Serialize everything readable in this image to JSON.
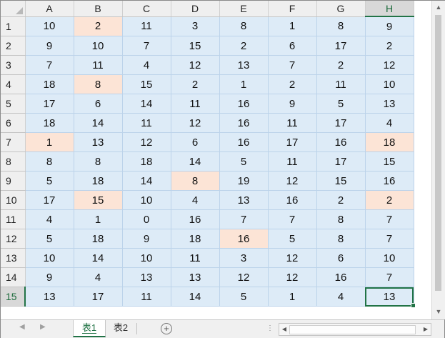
{
  "spreadsheet": {
    "columns": [
      "A",
      "B",
      "C",
      "D",
      "E",
      "F",
      "G",
      "H"
    ],
    "rows": [
      {
        "header": "1",
        "cells": [
          {
            "v": "10"
          },
          {
            "v": "2",
            "hl": true
          },
          {
            "v": "11"
          },
          {
            "v": "3"
          },
          {
            "v": "8"
          },
          {
            "v": "1"
          },
          {
            "v": "8"
          },
          {
            "v": "9"
          }
        ]
      },
      {
        "header": "2",
        "cells": [
          {
            "v": "9"
          },
          {
            "v": "10"
          },
          {
            "v": "7"
          },
          {
            "v": "15"
          },
          {
            "v": "2"
          },
          {
            "v": "6"
          },
          {
            "v": "17"
          },
          {
            "v": "2"
          }
        ]
      },
      {
        "header": "3",
        "cells": [
          {
            "v": "7"
          },
          {
            "v": "11"
          },
          {
            "v": "4"
          },
          {
            "v": "12"
          },
          {
            "v": "13"
          },
          {
            "v": "7"
          },
          {
            "v": "2"
          },
          {
            "v": "12"
          }
        ]
      },
      {
        "header": "4",
        "cells": [
          {
            "v": "18"
          },
          {
            "v": "8",
            "hl": true
          },
          {
            "v": "15"
          },
          {
            "v": "2"
          },
          {
            "v": "1"
          },
          {
            "v": "2"
          },
          {
            "v": "11"
          },
          {
            "v": "10"
          }
        ]
      },
      {
        "header": "5",
        "cells": [
          {
            "v": "17"
          },
          {
            "v": "6"
          },
          {
            "v": "14"
          },
          {
            "v": "11"
          },
          {
            "v": "16"
          },
          {
            "v": "9"
          },
          {
            "v": "5"
          },
          {
            "v": "13"
          }
        ]
      },
      {
        "header": "6",
        "cells": [
          {
            "v": "18"
          },
          {
            "v": "14"
          },
          {
            "v": "11"
          },
          {
            "v": "12"
          },
          {
            "v": "16"
          },
          {
            "v": "11"
          },
          {
            "v": "17"
          },
          {
            "v": "4"
          }
        ]
      },
      {
        "header": "7",
        "cells": [
          {
            "v": "1",
            "hl": true
          },
          {
            "v": "13"
          },
          {
            "v": "12"
          },
          {
            "v": "6"
          },
          {
            "v": "16"
          },
          {
            "v": "17"
          },
          {
            "v": "16"
          },
          {
            "v": "18",
            "hl": true
          }
        ]
      },
      {
        "header": "8",
        "cells": [
          {
            "v": "8"
          },
          {
            "v": "8"
          },
          {
            "v": "18"
          },
          {
            "v": "14"
          },
          {
            "v": "5"
          },
          {
            "v": "11"
          },
          {
            "v": "17"
          },
          {
            "v": "15"
          }
        ]
      },
      {
        "header": "9",
        "cells": [
          {
            "v": "5"
          },
          {
            "v": "18"
          },
          {
            "v": "14"
          },
          {
            "v": "8",
            "hl": true
          },
          {
            "v": "19"
          },
          {
            "v": "12"
          },
          {
            "v": "15"
          },
          {
            "v": "16"
          }
        ]
      },
      {
        "header": "10",
        "cells": [
          {
            "v": "17"
          },
          {
            "v": "15",
            "hl": true
          },
          {
            "v": "10"
          },
          {
            "v": "4"
          },
          {
            "v": "13"
          },
          {
            "v": "16"
          },
          {
            "v": "2"
          },
          {
            "v": "2",
            "hl": true
          }
        ]
      },
      {
        "header": "11",
        "cells": [
          {
            "v": "4"
          },
          {
            "v": "1"
          },
          {
            "v": "0"
          },
          {
            "v": "16"
          },
          {
            "v": "7"
          },
          {
            "v": "7"
          },
          {
            "v": "8"
          },
          {
            "v": "7"
          }
        ]
      },
      {
        "header": "12",
        "cells": [
          {
            "v": "5"
          },
          {
            "v": "18"
          },
          {
            "v": "9"
          },
          {
            "v": "18"
          },
          {
            "v": "16",
            "hl": true
          },
          {
            "v": "5"
          },
          {
            "v": "8"
          },
          {
            "v": "7"
          }
        ]
      },
      {
        "header": "13",
        "cells": [
          {
            "v": "10"
          },
          {
            "v": "14"
          },
          {
            "v": "10"
          },
          {
            "v": "11"
          },
          {
            "v": "3"
          },
          {
            "v": "12"
          },
          {
            "v": "6"
          },
          {
            "v": "10"
          }
        ]
      },
      {
        "header": "14",
        "cells": [
          {
            "v": "9"
          },
          {
            "v": "4"
          },
          {
            "v": "13"
          },
          {
            "v": "13"
          },
          {
            "v": "12"
          },
          {
            "v": "12"
          },
          {
            "v": "16"
          },
          {
            "v": "7"
          }
        ]
      },
      {
        "header": "15",
        "cells": [
          {
            "v": "13"
          },
          {
            "v": "17"
          },
          {
            "v": "11"
          },
          {
            "v": "14"
          },
          {
            "v": "5"
          },
          {
            "v": "1"
          },
          {
            "v": "4"
          },
          {
            "v": "13"
          }
        ]
      }
    ],
    "active_cell": {
      "row": 15,
      "col": "H"
    },
    "colors": {
      "cell_fill": "#ddebf7",
      "highlight_fill": "#fce4d6",
      "accent": "#217346"
    }
  },
  "sheet_tabs": [
    {
      "label": "表1",
      "active": true
    },
    {
      "label": "表2",
      "active": false
    }
  ],
  "icons": {
    "nav_prev": "◀",
    "nav_next": "▶",
    "add_sheet": "+",
    "scroll_up": "▲",
    "scroll_down": "▼",
    "scroll_left": "◀",
    "scroll_right": "▶"
  }
}
